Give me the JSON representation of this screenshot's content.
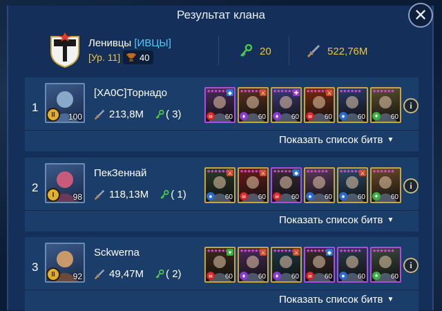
{
  "title": "Результат клана",
  "clan": {
    "name": "Ленивцы",
    "tag": "[ИВЦЫ]",
    "level": "[Ур. 11]",
    "trophies": "40",
    "keys": "20",
    "damage": "522,76M"
  },
  "show_battles_label": "Показать список битв",
  "players": [
    {
      "rank": "1",
      "name": "[XA0C]Торнадо",
      "avatar_level": "100",
      "rank_badge": "II",
      "damage": "213,8M",
      "keys": "( 3)",
      "champions": [
        {
          "level": "60",
          "border": "epic",
          "affinity": "force",
          "role": "defense",
          "bg": "#4a2a5a"
        },
        {
          "level": "60",
          "border": "legendary",
          "affinity": "void",
          "role": "attack",
          "bg": "#5a3020"
        },
        {
          "level": "60",
          "border": "legendary",
          "affinity": "void",
          "role": "support",
          "bg": "#3a3a7a"
        },
        {
          "level": "60",
          "border": "legendary",
          "affinity": "force",
          "role": "attack",
          "bg": "#7a2a10"
        },
        {
          "level": "60",
          "border": "legendary",
          "affinity": "magic",
          "role": "none",
          "bg": "#2a3a6a"
        },
        {
          "level": "60",
          "border": "legendary",
          "affinity": "spirit",
          "role": "none",
          "bg": "#5a5030"
        }
      ]
    },
    {
      "rank": "2",
      "name": "ПекЗеннай",
      "avatar_level": "98",
      "rank_badge": "I",
      "damage": "118,13M",
      "keys": "( 1)",
      "champions": [
        {
          "level": "60",
          "border": "legendary",
          "affinity": "magic",
          "role": "attack",
          "bg": "#2a3a2a"
        },
        {
          "level": "60",
          "border": "legendary",
          "affinity": "force",
          "role": "attack",
          "bg": "#6a1a1a"
        },
        {
          "level": "60",
          "border": "epic",
          "affinity": "force",
          "role": "defense",
          "bg": "#3a2a3a"
        },
        {
          "level": "60",
          "border": "legendary",
          "affinity": "magic",
          "role": "none",
          "bg": "#5a3a5a"
        },
        {
          "level": "60",
          "border": "legendary",
          "affinity": "magic",
          "role": "attack",
          "bg": "#2a4a6a"
        },
        {
          "level": "60",
          "border": "legendary",
          "affinity": "spirit",
          "role": "none",
          "bg": "#6a4a2a"
        }
      ]
    },
    {
      "rank": "3",
      "name": "Sckwerna",
      "avatar_level": "92",
      "rank_badge": "II",
      "damage": "49,47M",
      "keys": "( 2)",
      "champions": [
        {
          "level": "60",
          "border": "legendary",
          "affinity": "force",
          "role": "hp",
          "bg": "#3a2a1a"
        },
        {
          "level": "60",
          "border": "legendary",
          "affinity": "void",
          "role": "attack",
          "bg": "#4a2a5a"
        },
        {
          "level": "60",
          "border": "legendary",
          "affinity": "void",
          "role": "attack",
          "bg": "#1a3a4a"
        },
        {
          "level": "60",
          "border": "epic",
          "affinity": "force",
          "role": "defense",
          "bg": "#3a2a2a"
        },
        {
          "level": "60",
          "border": "epic",
          "affinity": "magic",
          "role": "none",
          "bg": "#2a3a4a"
        },
        {
          "level": "60",
          "border": "epic",
          "affinity": "spirit",
          "role": "none",
          "bg": "#3a4a3a"
        }
      ]
    }
  ],
  "colors": {
    "gold": "#f0c63a",
    "tag_blue": "#55c8ff",
    "key_green": "#4ec84a",
    "row_bg": "#1b3d6a",
    "panel_bg": "#14305a"
  }
}
